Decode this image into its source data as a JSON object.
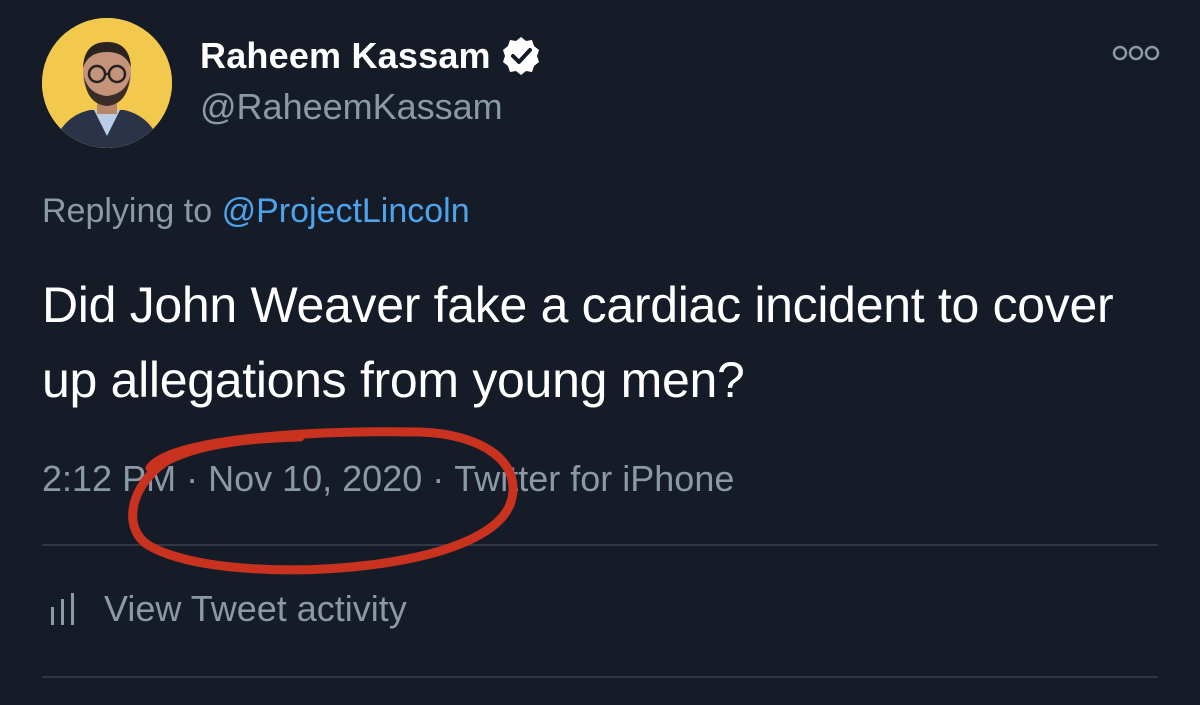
{
  "author": {
    "display_name": "Raheem Kassam",
    "handle": "@RaheemKassam",
    "verified": true
  },
  "reply": {
    "prefix": "Replying to",
    "mention": "@ProjectLincoln"
  },
  "tweet": {
    "text": "Did John Weaver fake a cardiac incident to cover up allegations from young men?"
  },
  "meta": {
    "time": "2:12 PM",
    "separator": "·",
    "date": "Nov 10, 2020",
    "source": "Twitter for iPhone"
  },
  "activity": {
    "label": "View Tweet activity"
  },
  "colors": {
    "background": "#151c28",
    "secondary_text": "#8b98a5",
    "link": "#4da3ec",
    "annotation_circle": "#c8321e"
  },
  "icons": {
    "verified": "verified-badge-icon",
    "more": "more-options-icon",
    "activity": "bar-chart-icon"
  }
}
